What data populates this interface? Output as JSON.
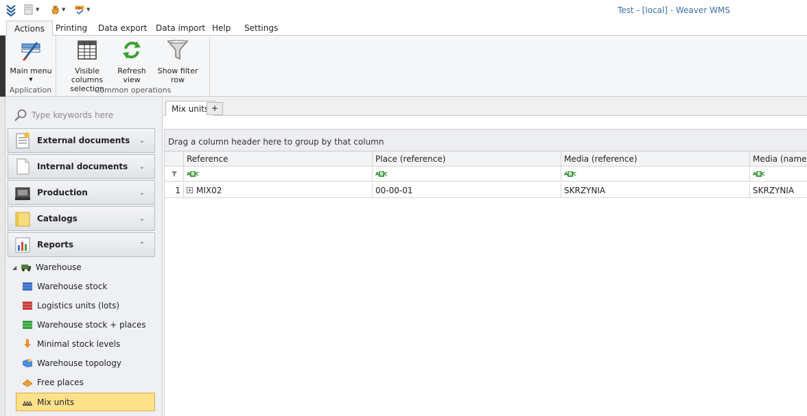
{
  "window": {
    "title": "Test - [local] - Weaver WMS"
  },
  "ribbon": {
    "tabs": [
      "Actions",
      "Printing",
      "Data export",
      "Data import",
      "Help",
      "Settings"
    ],
    "groups": {
      "application": {
        "label": "Application",
        "main_menu": "Main menu"
      },
      "common": {
        "label": "Common operations",
        "visible_columns_line1": "Visible columns",
        "visible_columns_line2": "selection",
        "refresh_line1": "Refresh",
        "refresh_line2": "view",
        "show_filter": "Show filter row"
      }
    }
  },
  "nav": {
    "search_placeholder": "Type keywords here",
    "groups": [
      "External documents",
      "Internal documents",
      "Production",
      "Catalogs",
      "Reports"
    ],
    "tree": {
      "parent": "Warehouse",
      "children": [
        "Warehouse stock",
        "Logistics units (lots)",
        "Warehouse stock + places",
        "Minimal stock levels",
        "Warehouse topology",
        "Free places",
        "Mix units"
      ]
    }
  },
  "content": {
    "doc_tab": "Mix units",
    "add_tab": "+",
    "group_panel_text": "Drag a column header here to group by that column",
    "columns": [
      "Reference",
      "Place (reference)",
      "Media (reference)",
      "Media (name)"
    ],
    "filter_icon": "ABC",
    "rows": [
      {
        "num": "1",
        "reference": "MIX02",
        "place": "00-00-01",
        "media_ref": "SKRZYNIA",
        "media_name": "SKRZYNIA"
      }
    ]
  },
  "colors": {
    "accent": "#3a6fa8",
    "selected_bg": "#fde28b",
    "selected_border": "#e0a83a"
  }
}
